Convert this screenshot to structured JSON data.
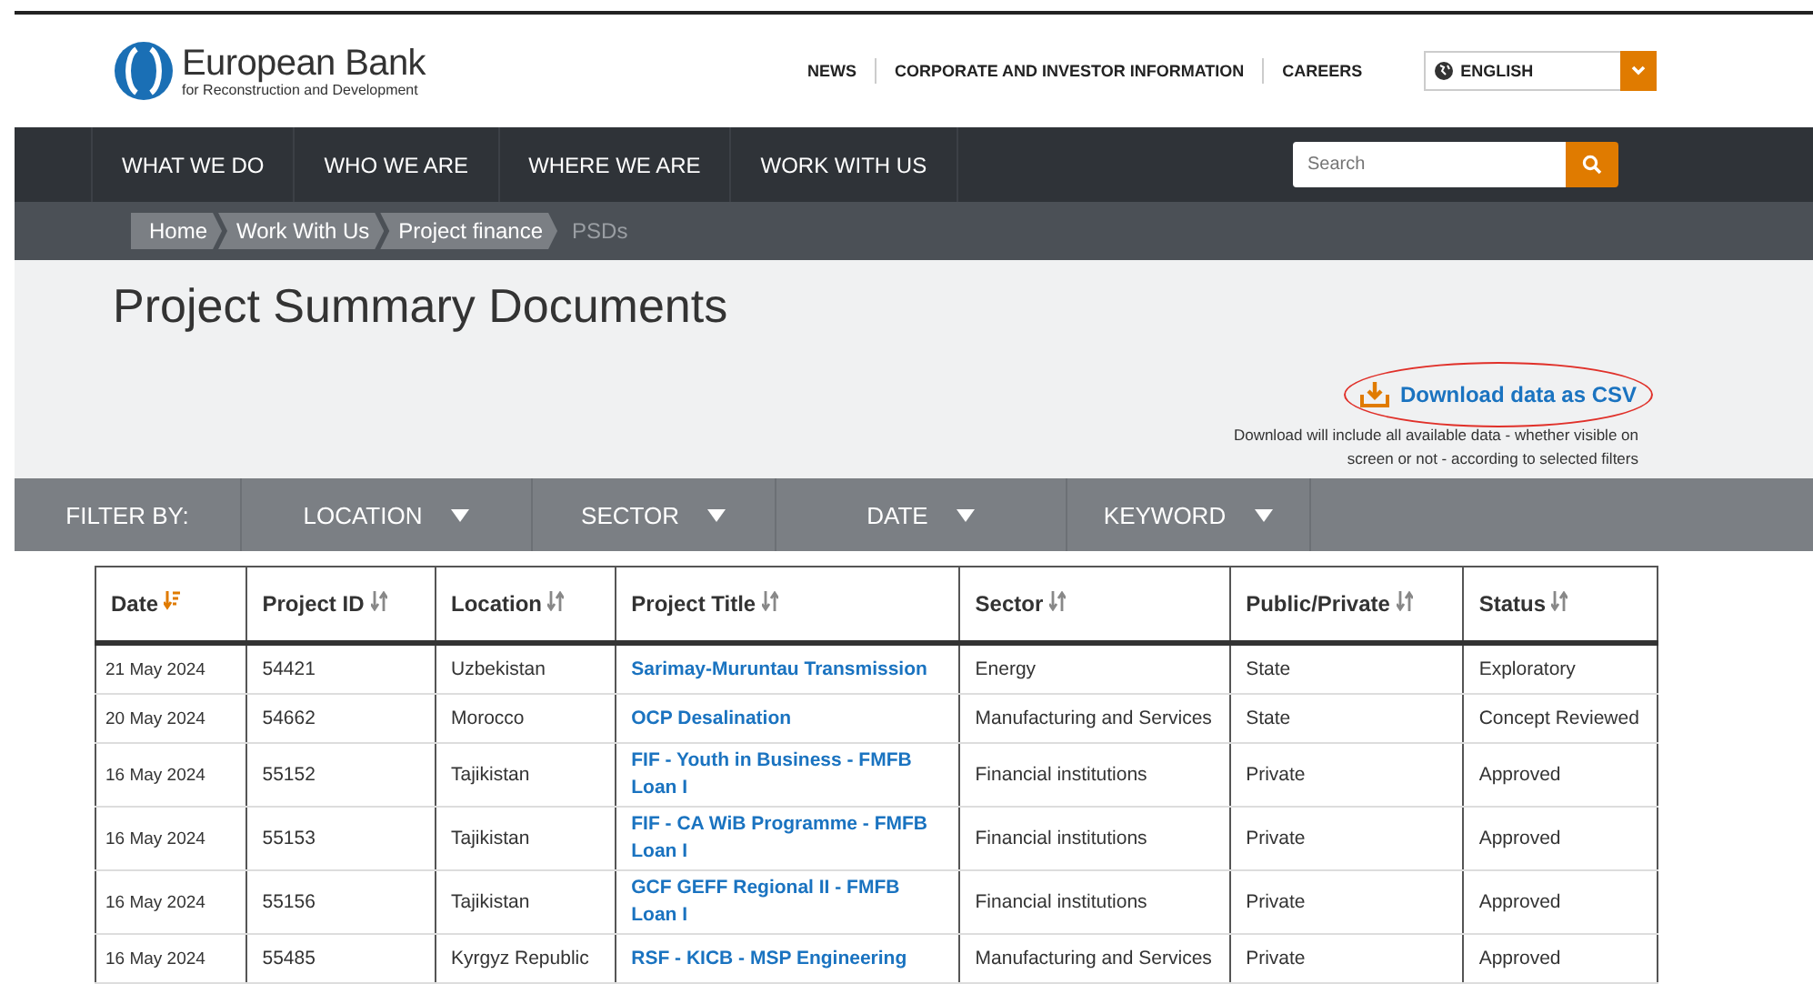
{
  "logo": {
    "name": "European Bank",
    "tagline": "for Reconstruction and Development"
  },
  "top_links": [
    "NEWS",
    "CORPORATE AND INVESTOR INFORMATION",
    "CAREERS"
  ],
  "language": {
    "value": "ENGLISH"
  },
  "nav": [
    "WHAT WE DO",
    "WHO WE ARE",
    "WHERE WE ARE",
    "WORK WITH US"
  ],
  "search": {
    "placeholder": "Search"
  },
  "breadcrumb": [
    {
      "label": "Home",
      "current": false
    },
    {
      "label": "Work With Us",
      "current": false
    },
    {
      "label": "Project finance",
      "current": false
    },
    {
      "label": "PSDs",
      "current": true
    }
  ],
  "page_title": "Project Summary Documents",
  "download": {
    "label": "Download data as CSV",
    "highlighted": true,
    "note": "Download will include all available data - whether visible on screen or not - according to selected filters"
  },
  "filter": {
    "label": "FILTER BY:",
    "options": [
      "LOCATION",
      "SECTOR",
      "DATE",
      "KEYWORD"
    ]
  },
  "table": {
    "columns": [
      {
        "label": "Date",
        "sort_active": true
      },
      {
        "label": "Project ID",
        "sort_active": false
      },
      {
        "label": "Location",
        "sort_active": false
      },
      {
        "label": "Project Title",
        "sort_active": false
      },
      {
        "label": "Sector",
        "sort_active": false
      },
      {
        "label": "Public/Private",
        "sort_active": false
      },
      {
        "label": "Status",
        "sort_active": false
      }
    ],
    "rows": [
      [
        "21 May 2024",
        "54421",
        "Uzbekistan",
        "Sarimay-Muruntau Transmission",
        "Energy",
        "State",
        "Exploratory"
      ],
      [
        "20 May 2024",
        "54662",
        "Morocco",
        "OCP Desalination",
        "Manufacturing and Services",
        "State",
        "Concept Reviewed"
      ],
      [
        "16 May 2024",
        "55152",
        "Tajikistan",
        "FIF - Youth in Business - FMFB Loan I",
        "Financial institutions",
        "Private",
        "Approved"
      ],
      [
        "16 May 2024",
        "55153",
        "Tajikistan",
        "FIF - CA WiB Programme - FMFB Loan I",
        "Financial institutions",
        "Private",
        "Approved"
      ],
      [
        "16 May 2024",
        "55156",
        "Tajikistan",
        "GCF GEFF Regional II - FMFB Loan I",
        "Financial institutions",
        "Private",
        "Approved"
      ],
      [
        "16 May 2024",
        "55485",
        "Kyrgyz Republic",
        "RSF - KICB - MSP Engineering",
        "Manufacturing and Services",
        "Private",
        "Approved"
      ]
    ]
  }
}
